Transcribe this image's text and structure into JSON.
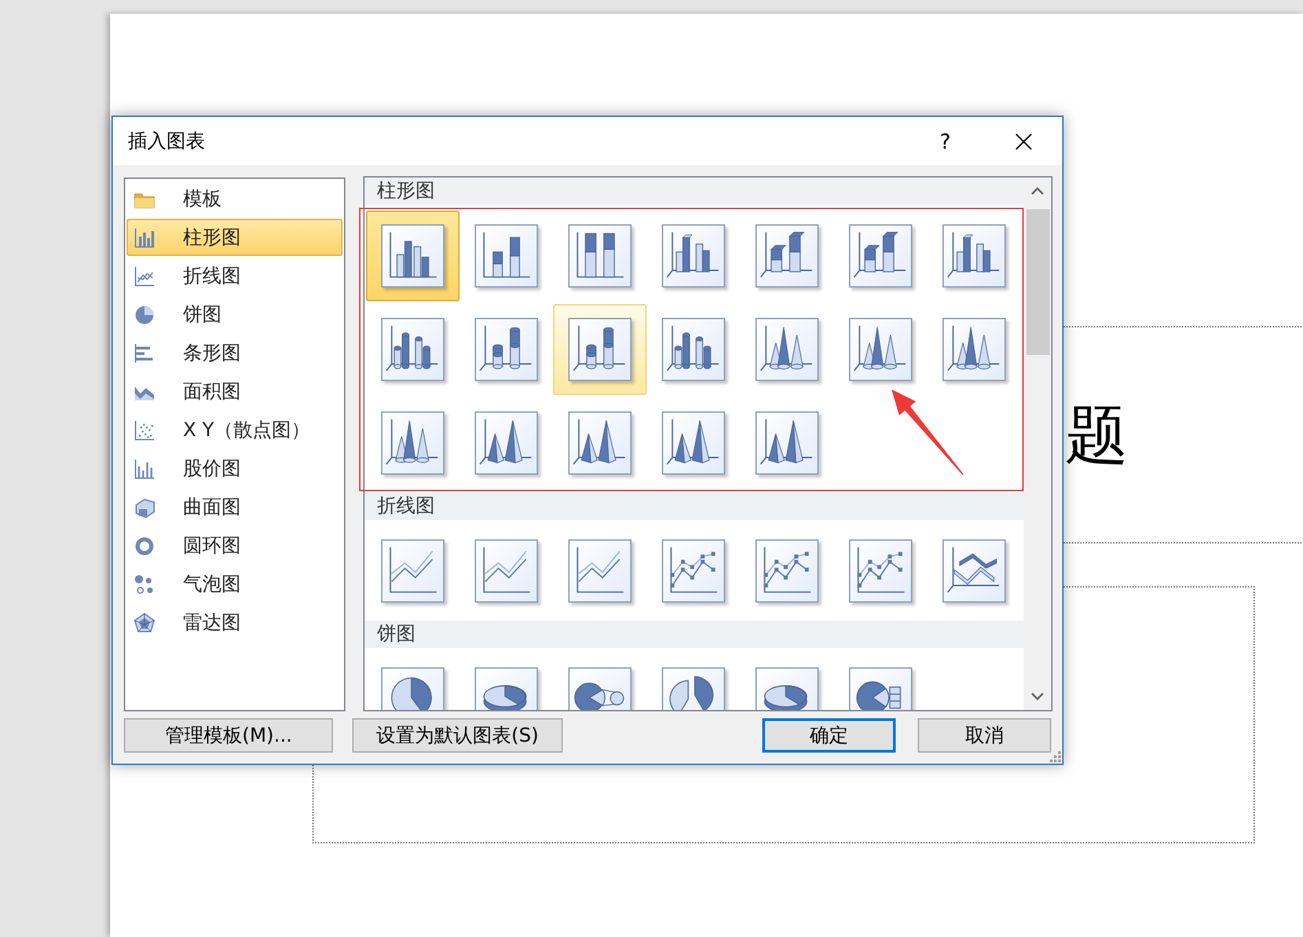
{
  "slide": {
    "title_fragment": "题"
  },
  "dialog": {
    "title": "插入图表",
    "help_button": "?",
    "sidebar": {
      "items": [
        {
          "kind": "folder",
          "label": "模板",
          "selected": false
        },
        {
          "kind": "column",
          "label": "柱形图",
          "selected": true
        },
        {
          "kind": "line",
          "label": "折线图",
          "selected": false
        },
        {
          "kind": "pie",
          "label": "饼图",
          "selected": false
        },
        {
          "kind": "bar",
          "label": "条形图",
          "selected": false
        },
        {
          "kind": "area",
          "label": "面积图",
          "selected": false
        },
        {
          "kind": "scatter",
          "label": "X Y（散点图）",
          "selected": false
        },
        {
          "kind": "stock",
          "label": "股价图",
          "selected": false
        },
        {
          "kind": "surface",
          "label": "曲面图",
          "selected": false
        },
        {
          "kind": "doughnut",
          "label": "圆环图",
          "selected": false
        },
        {
          "kind": "bubble",
          "label": "气泡图",
          "selected": false
        },
        {
          "kind": "radar",
          "label": "雷达图",
          "selected": false
        }
      ]
    },
    "sections": [
      {
        "title": "柱形图",
        "items": [
          {
            "kind": "column",
            "selected": true,
            "hovered": false
          },
          {
            "kind": "stacked-column",
            "selected": false,
            "hovered": false
          },
          {
            "kind": "full-column",
            "selected": false,
            "hovered": false
          },
          {
            "kind": "column-3d",
            "selected": false,
            "hovered": false
          },
          {
            "kind": "stacked-column-3d",
            "selected": false,
            "hovered": false
          },
          {
            "kind": "stacked-column-3d",
            "selected": false,
            "hovered": false
          },
          {
            "kind": "column-3d",
            "selected": false,
            "hovered": false
          },
          {
            "kind": "cylinder",
            "selected": false,
            "hovered": false
          },
          {
            "kind": "stacked-cylinder",
            "selected": false,
            "hovered": false
          },
          {
            "kind": "stacked-cylinder",
            "selected": false,
            "hovered": true
          },
          {
            "kind": "cylinder",
            "selected": false,
            "hovered": false
          },
          {
            "kind": "cone",
            "selected": false,
            "hovered": false
          },
          {
            "kind": "cone",
            "selected": false,
            "hovered": false
          },
          {
            "kind": "cone",
            "selected": false,
            "hovered": false
          },
          {
            "kind": "cone",
            "selected": false,
            "hovered": false
          },
          {
            "kind": "pyramid",
            "selected": false,
            "hovered": false
          },
          {
            "kind": "pyramid",
            "selected": false,
            "hovered": false
          },
          {
            "kind": "pyramid",
            "selected": false,
            "hovered": false
          },
          {
            "kind": "pyramid",
            "selected": false,
            "hovered": false
          }
        ]
      },
      {
        "title": "折线图",
        "items": [
          {
            "kind": "line",
            "selected": false,
            "hovered": false
          },
          {
            "kind": "line",
            "selected": false,
            "hovered": false
          },
          {
            "kind": "line",
            "selected": false,
            "hovered": false
          },
          {
            "kind": "line-markers",
            "selected": false,
            "hovered": false
          },
          {
            "kind": "line-markers",
            "selected": false,
            "hovered": false
          },
          {
            "kind": "line-markers",
            "selected": false,
            "hovered": false
          },
          {
            "kind": "line-3d",
            "selected": false,
            "hovered": false
          }
        ]
      },
      {
        "title": "饼图",
        "items": [
          {
            "kind": "pie",
            "selected": false,
            "hovered": false
          },
          {
            "kind": "pie-3d",
            "selected": false,
            "hovered": false
          },
          {
            "kind": "pie-of-pie",
            "selected": false,
            "hovered": false
          },
          {
            "kind": "exploded-pie",
            "selected": false,
            "hovered": false
          },
          {
            "kind": "pie-3d",
            "selected": false,
            "hovered": false
          },
          {
            "kind": "bar-of-pie",
            "selected": false,
            "hovered": false
          }
        ]
      }
    ],
    "buttons": [
      {
        "label": "管理模板(M)...",
        "default": false
      },
      {
        "label": "设置为默认图表(S)",
        "default": false
      },
      {
        "label": "确定",
        "default": true
      },
      {
        "label": "取消",
        "default": false
      }
    ]
  }
}
